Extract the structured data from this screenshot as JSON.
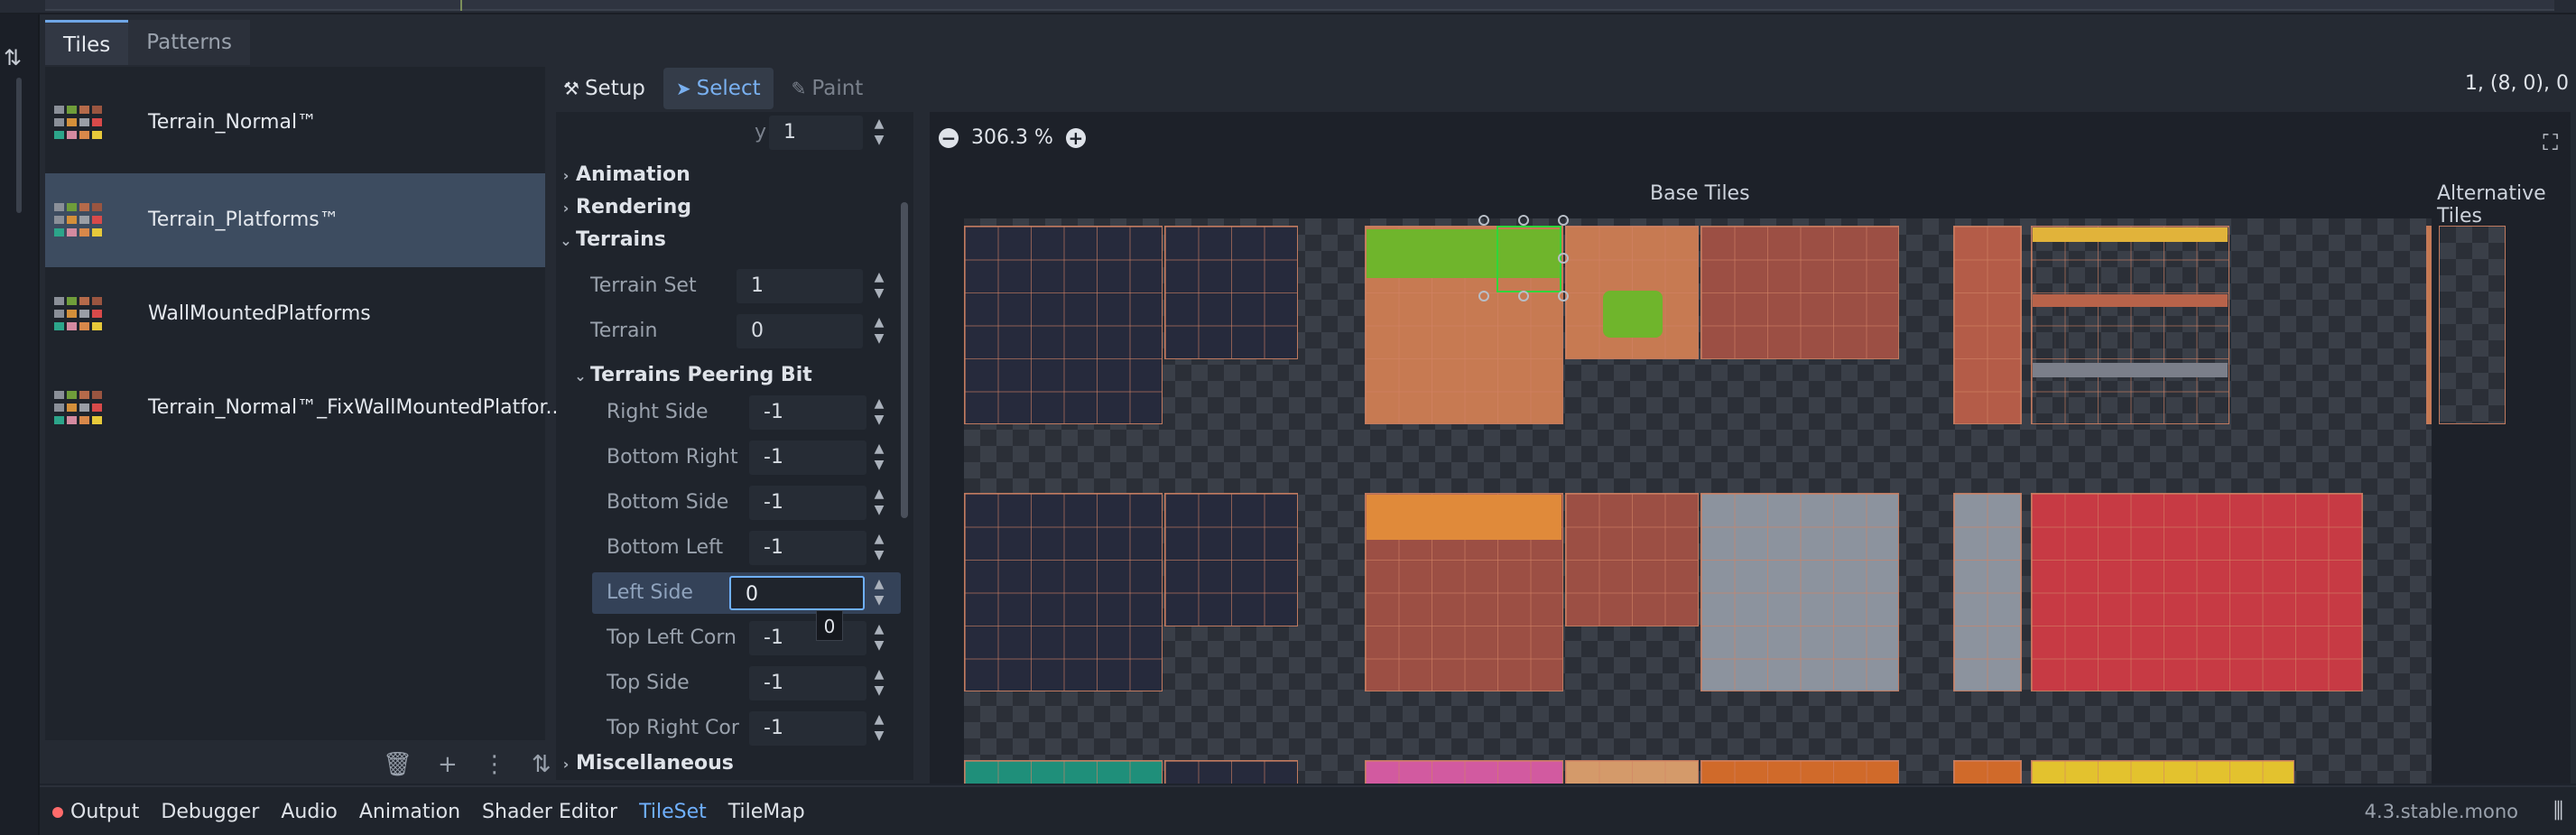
{
  "tabs": [
    {
      "label": "Tiles"
    },
    {
      "label": "Patterns"
    }
  ],
  "sources": [
    {
      "name": "Terrain_Normal™"
    },
    {
      "name": "Terrain_Platforms™"
    },
    {
      "name": "WallMountedPlatforms"
    },
    {
      "name": "Terrain_Normal™_FixWallMountedPlatfor..."
    }
  ],
  "modes": [
    {
      "label": "Setup"
    },
    {
      "label": "Select"
    },
    {
      "label": "Paint"
    }
  ],
  "inspector": {
    "y_label": "y",
    "y_value": "1",
    "sections": {
      "animation": "Animation",
      "rendering": "Rendering",
      "terrains": "Terrains",
      "peering": "Terrains Peering Bit",
      "misc": "Miscellaneous"
    },
    "terrain_set": {
      "label": "Terrain Set",
      "value": "1"
    },
    "terrain": {
      "label": "Terrain",
      "value": "0"
    },
    "peering": [
      {
        "label": "Right Side",
        "value": "-1"
      },
      {
        "label": "Bottom Right",
        "value": "-1"
      },
      {
        "label": "Bottom Side",
        "value": "-1"
      },
      {
        "label": "Bottom Left",
        "value": "-1"
      },
      {
        "label": "Left Side",
        "value": "0"
      },
      {
        "label": "Top Left Corn",
        "value": "-1"
      },
      {
        "label": "Top Side",
        "value": "-1"
      },
      {
        "label": "Top Right Cor",
        "value": "-1"
      }
    ],
    "tooltip": "0"
  },
  "atlas": {
    "zoom": "306.3 %",
    "coords": "1, (8, 0), 0",
    "base_header": "Base Tiles",
    "alt_header": "Alternative Tiles"
  },
  "bottombar": {
    "items": [
      "Output",
      "Debugger",
      "Audio",
      "Animation",
      "Shader Editor",
      "TileSet",
      "TileMap"
    ],
    "active": "TileSet",
    "version": "4.3.stable.mono"
  },
  "colors": {
    "accent": "#6fb0ff",
    "selection": "#3d4c60",
    "terrain_select": "#2fd63a"
  }
}
